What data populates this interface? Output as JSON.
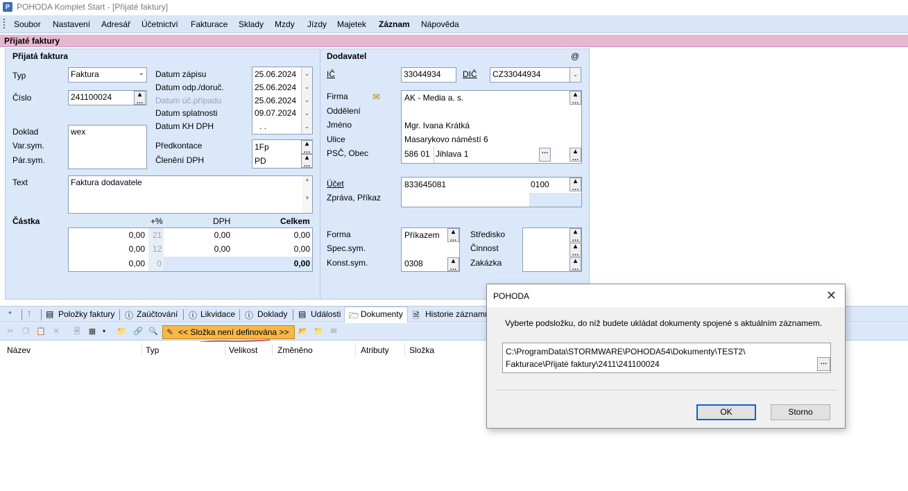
{
  "window": {
    "title": "POHODA Komplet Start - [Přijaté faktury]"
  },
  "menu": {
    "items": [
      "Soubor",
      "Nastavení",
      "Adresář",
      "Účetnictví",
      "Fakturace",
      "Sklady",
      "Mzdy",
      "Jízdy",
      "Majetek",
      "Záznam",
      "Nápověda"
    ]
  },
  "section": {
    "title": "Přijaté faktury"
  },
  "invoice": {
    "heading": "Přijatá faktura",
    "typ_label": "Typ",
    "typ_value": "Faktura",
    "cislo_label": "Číslo",
    "cislo_value": "241100024",
    "doklad_label": "Doklad",
    "varsym_label": "Var.sym.",
    "parsym_label": "Pár.sym.",
    "doklad_value": "wex",
    "text_label": "Text",
    "text_value": "Faktura dodavatele",
    "datum_zapisu_label": "Datum zápisu",
    "datum_zapisu": "25.06.2024",
    "datum_odp_label": "Datum odp./doruč.",
    "datum_odp": "25.06.2024",
    "datum_uc_label": "Datum úč.případu",
    "datum_uc": "25.06.2024",
    "datum_splat_label": "Datum splatnosti",
    "datum_splat": "09.07.2024",
    "datum_kh_label": "Datum KH DPH",
    "datum_kh": ". .",
    "predkontace_label": "Předkontace",
    "predkontace": "1Fp",
    "cleneni_label": "Členění DPH",
    "cleneni": "PD"
  },
  "amounts": {
    "castka_label": "Částka",
    "pct_label": "+%",
    "dph_label": "DPH",
    "celkem_label": "Celkem",
    "rows": [
      {
        "base": "0,00",
        "rate": "21",
        "vat": "0,00",
        "total": "0,00"
      },
      {
        "base": "0,00",
        "rate": "12",
        "vat": "0,00",
        "total": "0,00"
      },
      {
        "base": "0,00",
        "rate": "0",
        "vat": "",
        "total": "0,00"
      }
    ]
  },
  "supplier": {
    "heading": "Dodavatel",
    "at": "@",
    "ic_label": "IČ",
    "ic": "33044934",
    "dic_label": "DIČ",
    "dic": "CZ33044934",
    "firma_label": "Firma",
    "firma": "AK - Media a. s.",
    "oddeleni_label": "Oddělení",
    "jmeno_label": "Jméno",
    "jmeno": "Mgr. Ivana Krátká",
    "ulice_label": "Ulice",
    "ulice": "Masarykovo náměstí 6",
    "psc_label": "PSČ, Obec",
    "psc": "586 01",
    "obec": "Jihlava 1",
    "ucet_label": "Účet",
    "ucet": "833645081",
    "banka": "0100",
    "zprava_label": "Zpráva, Příkaz",
    "forma_label": "Forma",
    "forma": "Příkazem",
    "specsym_label": "Spec.sym.",
    "konstsym_label": "Konst.sym.",
    "konstsym": "0308",
    "stredisko_label": "Středisko",
    "cinnost_label": "Činnost",
    "zakazka_label": "Zakázka"
  },
  "tabs": [
    "*",
    "Položky faktury",
    "Zaúčtování",
    "Likvidace",
    "Doklady",
    "Události",
    "Dokumenty",
    "Historie záznamu"
  ],
  "toolbar": {
    "folder_label": "<< Složka není definována >>"
  },
  "columns": [
    "Název",
    "Typ",
    "Velikost",
    "Změněno",
    "Atributy",
    "Složka"
  ],
  "dialog": {
    "title": "POHODA",
    "message": "Vyberte podsložku, do níž budete ukládat dokumenty spojené s aktuálním záznamem.",
    "path_line1": "C:\\ProgramData\\STORMWARE\\POHODA54\\Dokumenty\\TEST2\\",
    "path_line2": "Fakturace\\Přijaté faktury\\2411\\241100024",
    "ok": "OK",
    "cancel": "Storno"
  }
}
